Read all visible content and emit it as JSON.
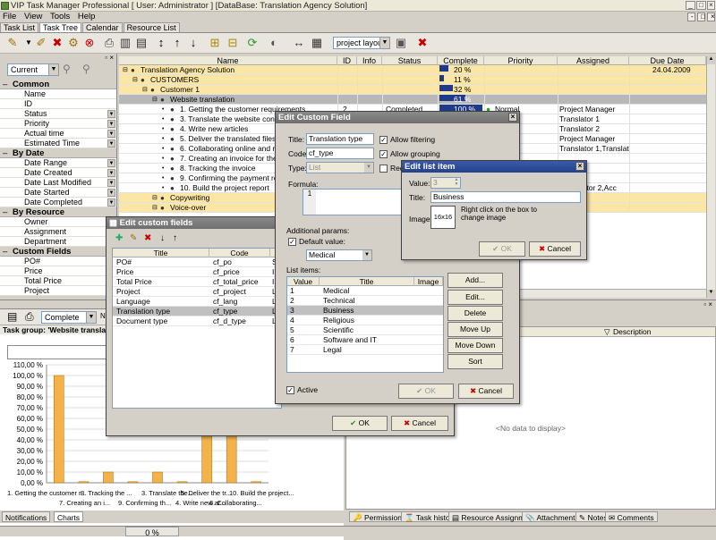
{
  "app": {
    "title": "VIP Task Manager Professional [ User: Administrator ] [DataBase: Translation Agency Solution]"
  },
  "menu": [
    "File",
    "View",
    "Tools",
    "Help"
  ],
  "view_tabs": [
    "Task List",
    "Task Tree",
    "Calendar",
    "Resource List"
  ],
  "active_view_tab": "Task Tree",
  "toolbar": {
    "layout_select": "project layout"
  },
  "filter_panel": {
    "view_select": "Current",
    "groups": [
      {
        "label": "Common",
        "items": [
          "Name",
          "ID",
          "Status",
          "Priority",
          "Actual time",
          "Estimated Time"
        ]
      },
      {
        "label": "By Date",
        "items": [
          "Date Range",
          "Date Created",
          "Date Last Modified",
          "Date Started",
          "Date Completed"
        ]
      },
      {
        "label": "By Resource",
        "items": [
          "Owner",
          "Assignment",
          "Department"
        ]
      },
      {
        "label": "Custom Fields",
        "items": [
          "PO#",
          "Price",
          "Total Price",
          "Project"
        ]
      }
    ]
  },
  "grid": {
    "columns": [
      "Name",
      "ID",
      "Info",
      "Status",
      "Complete",
      "Priority",
      "Assigned",
      "Due Date"
    ],
    "rows": [
      {
        "name": "Translation Agency Solution",
        "complete": "20 %",
        "due": "24.04.2009",
        "level": 0,
        "hl": true,
        "pct": 20
      },
      {
        "name": "CUSTOMERS",
        "complete": "11 %",
        "level": 1,
        "hl": true,
        "pct": 11
      },
      {
        "name": "Customer 1",
        "complete": "32 %",
        "level": 2,
        "hl": true,
        "pct": 32
      },
      {
        "name": "Website translation",
        "complete": "61 %",
        "level": 3,
        "sel": true,
        "pct": 61
      },
      {
        "name": "1. Getting the customer requirements",
        "id": "2",
        "status": "Completed",
        "complete": "100 %",
        "priority": "Normal",
        "assigned": "Project Manager",
        "level": 4,
        "pct": 100
      },
      {
        "name": "3. Translate the website content",
        "assigned": "Translator 1",
        "level": 4
      },
      {
        "name": "4. Write new articles",
        "assigned": "Translator 2",
        "level": 4
      },
      {
        "name": "5. Deliver the translated files to the customer",
        "assigned": "Project Manager",
        "level": 4
      },
      {
        "name": "6. Collaborating online and resolving",
        "assigned": "Translator 1,Translator 2",
        "level": 4
      },
      {
        "name": "7. Creating an invoice for the PO",
        "level": 4
      },
      {
        "name": "8. Tracking the invoice",
        "level": 4
      },
      {
        "name": "9. Confirming the payment receipt",
        "level": 4
      },
      {
        "name": "10. Build the project report",
        "assigned": ",Translator 2,Acc",
        "level": 4
      },
      {
        "name": "Copywriting",
        "level": 3,
        "hl": true
      },
      {
        "name": "Voice-over",
        "level": 3,
        "hl": true
      }
    ]
  },
  "bottom_left": {
    "status_select": "Complete",
    "task_group_label": "Task group: 'Website translation'",
    "tabs": [
      "Notifications",
      "Charts"
    ]
  },
  "chart_data": {
    "type": "bar",
    "ylim": [
      0,
      110
    ],
    "yticks": [
      "110,00 %",
      "100,00 %",
      "90,00 %",
      "80,00 %",
      "70,00 %",
      "60,00 %",
      "50,00 %",
      "40,00 %",
      "30,00 %",
      "20,00 %",
      "10,00 %",
      "0,00 %"
    ],
    "categories": [
      "1. Getting the customer r...",
      "7. Creating an i...",
      "8. Tracking the ...",
      "9. Confirming th...",
      "3. Translate the...",
      "4. Write new ar...",
      "5. Deliver the tr...",
      "6. Collaborating...",
      "10. Build the project..."
    ],
    "values": [
      100,
      1,
      10,
      1,
      10,
      1,
      60,
      60,
      1
    ],
    "legend": "Complete",
    "bar_color": "#f4b24a"
  },
  "bottom_right": {
    "column_header": "Description",
    "empty_text": "<No data to display>",
    "tabs": [
      "Permissions",
      "Task history",
      "Resource Assignment",
      "Attachments",
      "Notes",
      "Comments"
    ]
  },
  "status_bar": {
    "progress_text": "0 %"
  },
  "dialog_custom_fields": {
    "title": "Edit custom fields",
    "columns": [
      "Title",
      "Code"
    ],
    "rows": [
      {
        "title": "PO#",
        "code": "cf_po",
        "type": "St"
      },
      {
        "title": "Price",
        "code": "cf_price",
        "type": "In"
      },
      {
        "title": "Total Price",
        "code": "cf_total_price",
        "type": "In"
      },
      {
        "title": "Project",
        "code": "cf_project",
        "type": "Lis"
      },
      {
        "title": "Language",
        "code": "cf_lang",
        "type": "Lis"
      },
      {
        "title": "Translation type",
        "code": "cf_type",
        "type": "Lis",
        "sel": true
      },
      {
        "title": "Document type",
        "code": "cf_d_type",
        "type": "Lis"
      }
    ],
    "ok": "OK",
    "cancel": "Cancel"
  },
  "dialog_custom_field": {
    "title": "Edit Custom Field",
    "title_label": "Title:",
    "title_value": "Translation type",
    "code_label": "Code:",
    "code_value": "cf_type",
    "type_label": "Type:",
    "type_value": "List",
    "allow_filtering": "Allow filtering",
    "allow_grouping": "Allow grouping",
    "required": "Requ",
    "formula_label": "Formula:",
    "formula_line": "1",
    "additional_params": "Additional params:",
    "default_value_label": "Default value:",
    "default_value": "Medical",
    "list_items_label": "List items:",
    "list_columns": [
      "Value",
      "Title",
      "Image"
    ],
    "list_rows": [
      {
        "value": "1",
        "title": "Medical"
      },
      {
        "value": "2",
        "title": "Technical"
      },
      {
        "value": "3",
        "title": "Business",
        "sel": true
      },
      {
        "value": "4",
        "title": "Religious"
      },
      {
        "value": "5",
        "title": "Scientific"
      },
      {
        "value": "6",
        "title": "Software and IT"
      },
      {
        "value": "7",
        "title": "Legal"
      }
    ],
    "buttons": [
      "Add...",
      "Edit...",
      "Delete",
      "Move Up",
      "Move Down",
      "Sort"
    ],
    "active_label": "Active",
    "ok": "OK",
    "cancel": "Cancel"
  },
  "dialog_list_item": {
    "title": "Edit list item",
    "value_label": "Value:",
    "value": "3",
    "title_label": "Title:",
    "title_value": "Business",
    "image_label": "Image:",
    "image_box": "16x16",
    "hint": "Right click on the box to change image",
    "ok": "OK",
    "cancel": "Cancel"
  }
}
